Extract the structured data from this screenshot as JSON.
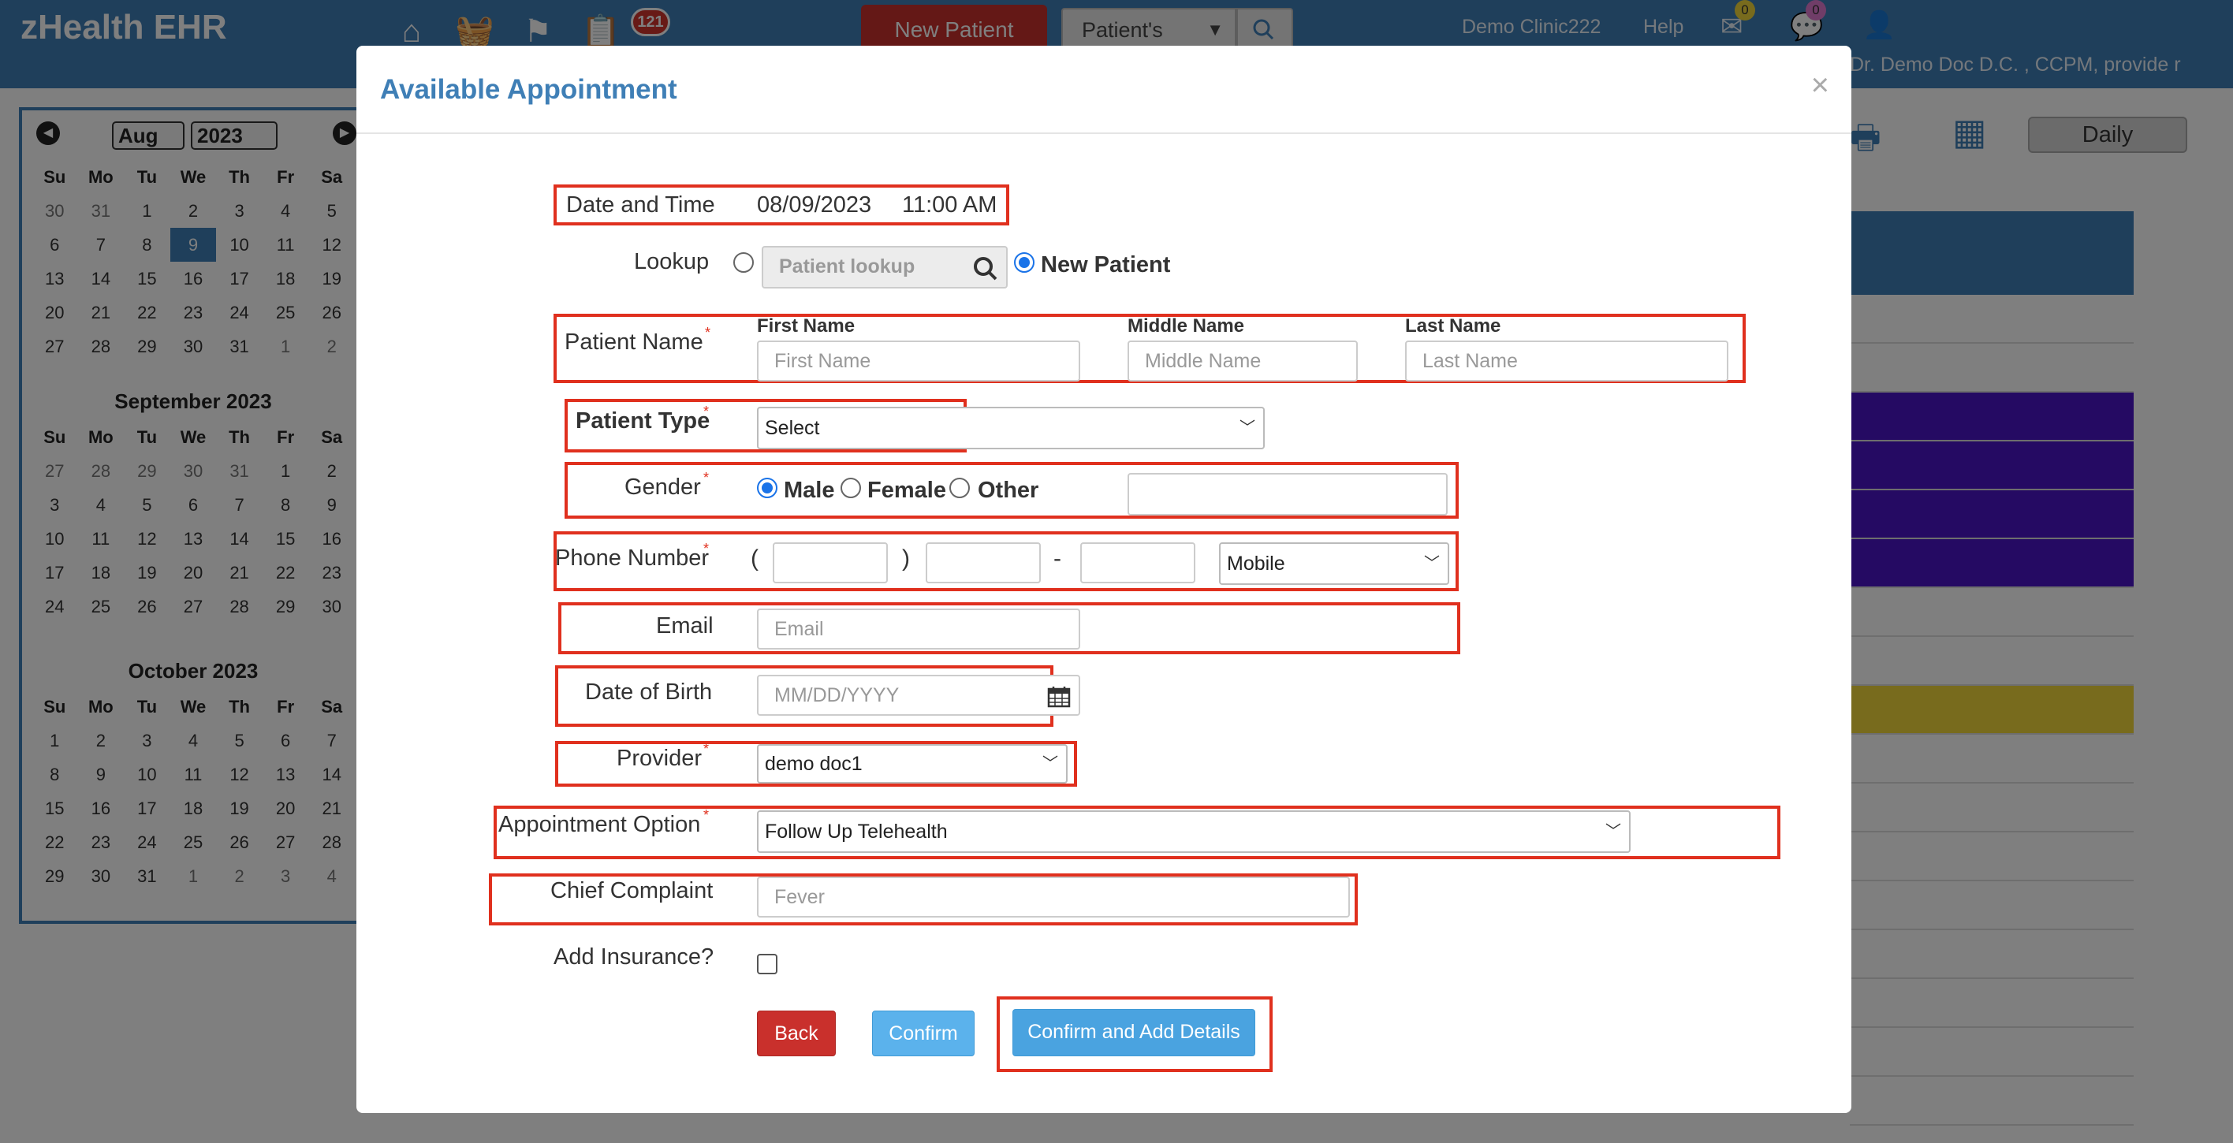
{
  "app": {
    "title": "zHealth EHR",
    "alert_count": "121",
    "new_patient_label": "New Patient",
    "patients_select": "Patient's",
    "clinic": "Demo Clinic222",
    "help": "Help",
    "messages_count": "0",
    "chat_count": "0",
    "user": "Dr. Demo Doc D.C. , CCPM, provide r",
    "view_mode": "Daily"
  },
  "calendar": {
    "selected_month": "Aug",
    "selected_year": "2023",
    "weekdays": [
      "Su",
      "Mo",
      "Tu",
      "We",
      "Th",
      "Fr",
      "Sa"
    ],
    "months": [
      {
        "title": "",
        "days": [
          "30",
          "31",
          "1",
          "2",
          "3",
          "4",
          "5",
          "6",
          "7",
          "8",
          "9",
          "10",
          "11",
          "12",
          "13",
          "14",
          "15",
          "16",
          "17",
          "18",
          "19",
          "20",
          "21",
          "22",
          "23",
          "24",
          "25",
          "26",
          "27",
          "28",
          "29",
          "30",
          "31",
          "1",
          "2"
        ]
      },
      {
        "title": "September 2023",
        "days": [
          "27",
          "28",
          "29",
          "30",
          "31",
          "1",
          "2",
          "3",
          "4",
          "5",
          "6",
          "7",
          "8",
          "9",
          "10",
          "11",
          "12",
          "13",
          "14",
          "15",
          "16",
          "17",
          "18",
          "19",
          "20",
          "21",
          "22",
          "23",
          "24",
          "25",
          "26",
          "27",
          "28",
          "29",
          "30"
        ]
      },
      {
        "title": "October 2023",
        "days": [
          "1",
          "2",
          "3",
          "4",
          "5",
          "6",
          "7",
          "8",
          "9",
          "10",
          "11",
          "12",
          "13",
          "14",
          "15",
          "16",
          "17",
          "18",
          "19",
          "20",
          "21",
          "22",
          "23",
          "24",
          "25",
          "26",
          "27",
          "28",
          "29",
          "30",
          "31",
          "1",
          "2",
          "3",
          "4"
        ]
      }
    ]
  },
  "modal": {
    "title": "Available Appointment",
    "close": "×",
    "date_time_label": "Date and Time",
    "date_value": "08/09/2023",
    "time_value": "11:00 AM",
    "lookup_label": "Lookup",
    "lookup_placeholder": "Patient lookup",
    "new_patient_option": "New Patient",
    "patient_name_label": "Patient Name",
    "first_name_label": "First Name",
    "middle_name_label": "Middle Name",
    "last_name_label": "Last Name",
    "first_name_placeholder": "First Name",
    "middle_name_placeholder": "Middle Name",
    "last_name_placeholder": "Last Name",
    "patient_type_label": "Patient Type",
    "patient_type_value": "Select",
    "gender_label": "Gender",
    "gender_options": [
      "Male",
      "Female",
      "Other"
    ],
    "gender_selected": "Male",
    "phone_label": "Phone Number",
    "phone_open": "(",
    "phone_close": ")",
    "phone_dash": "-",
    "phone_type": "Mobile",
    "email_label": "Email",
    "email_placeholder": "Email",
    "dob_label": "Date of Birth",
    "dob_placeholder": "MM/DD/YYYY",
    "provider_label": "Provider",
    "provider_value": "demo doc1",
    "appointment_option_label": "Appointment Option",
    "appointment_option_value": "Follow Up Telehealth",
    "chief_complaint_label": "Chief Complaint",
    "chief_complaint_placeholder": "Fever",
    "add_insurance_label": "Add Insurance?",
    "back_button": "Back",
    "confirm_button": "Confirm",
    "confirm_add_button": "Confirm and Add Details",
    "required_marker": "*"
  },
  "colors": {
    "brand": "#3f7fb6",
    "highlight": "#e0301e",
    "danger": "#c9302c",
    "primary": "#5bb2ec",
    "event_purple": "#4b14c7",
    "event_yellow": "#f1d73a"
  }
}
